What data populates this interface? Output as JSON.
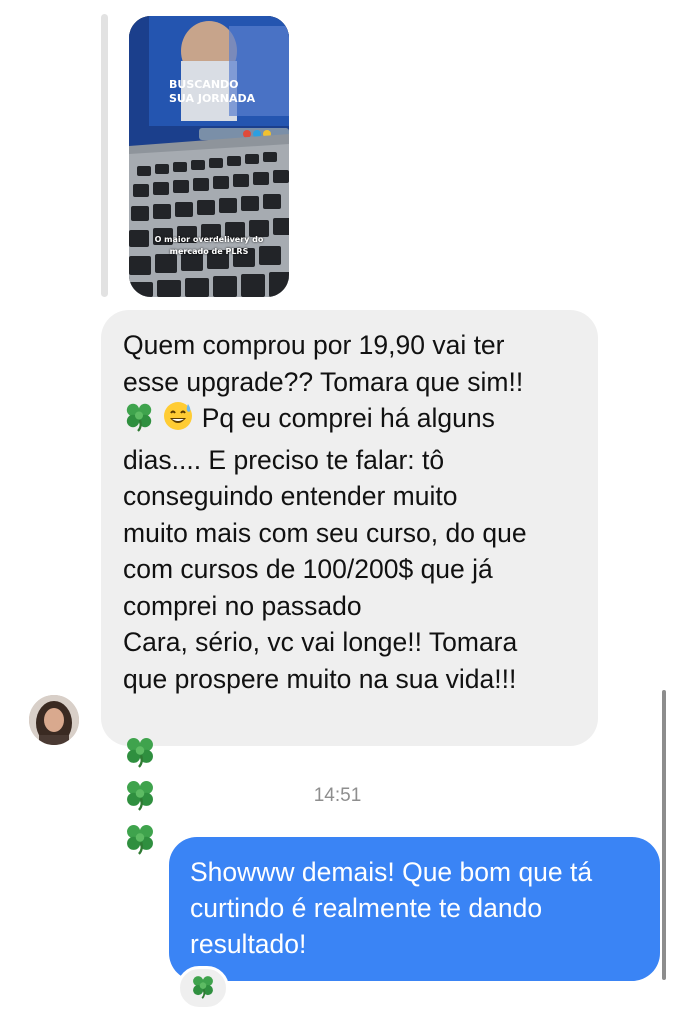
{
  "story_reply": {
    "caption_line1": "O maior overdelivery do",
    "caption_line2": "mercado de PLRS",
    "screen_text1": "BUSCANDO",
    "screen_text2": "SUA JORNADA"
  },
  "incoming_message": {
    "line1": "Quem comprou por 19,90 vai ter",
    "line2": "esse upgrade?? Tomara que sim!!",
    "line3_text": " Pq eu comprei há alguns",
    "line4": "dias.... E preciso te falar: tô",
    "line5": "conseguindo entender muito",
    "line6": "muito mais com seu curso, do que",
    "line7": "com cursos de 100/200$ que já",
    "line8": "comprei no passado",
    "line9": "Cara, sério, vc vai longe!! Tomara",
    "line10": "que prospere muito na sua vida!!!",
    "emoji_names": [
      "four-leaf-clover",
      "grinning-sweat-face"
    ]
  },
  "timestamp": "14:51",
  "outgoing_message": {
    "line1": "Showww demais! Que bom que tá",
    "line2": "curtindo é realmente te dando",
    "line3": "resultado!"
  },
  "reaction": {
    "emoji": "four-leaf-clover"
  },
  "colors": {
    "incoming_bubble": "#efefef",
    "outgoing_bubble": "#3a84f5",
    "timestamp": "#8e8e8e"
  }
}
